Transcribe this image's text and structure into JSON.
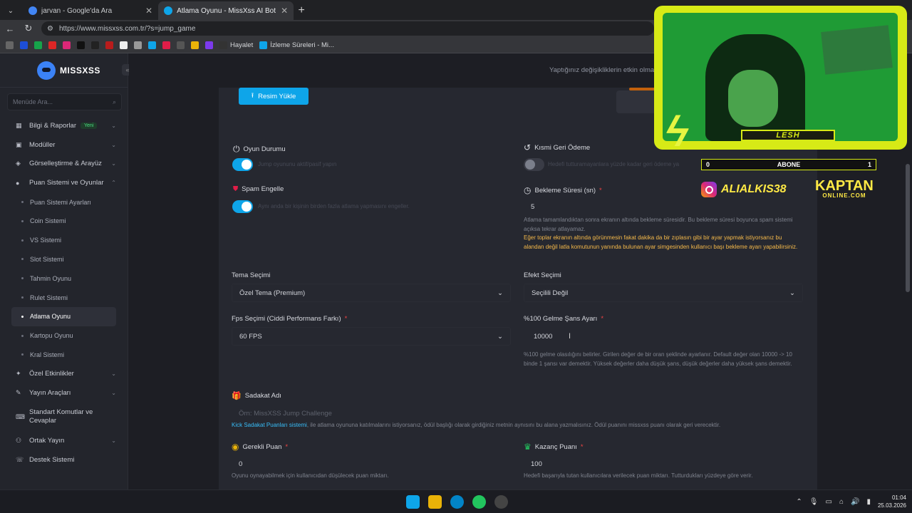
{
  "browser": {
    "tabs": [
      {
        "title": "jarvan - Google'da Ara",
        "favicon_color": "#4285f4",
        "active": false
      },
      {
        "title": "Atlama Oyunu - MissXss AI Bot Sy",
        "favicon_color": "#0ea5e9",
        "active": true
      }
    ],
    "url": "https://www.missxss.com.tr/?s=jump_game",
    "bookmarks": {
      "hayalet": "Hayalet",
      "izleme": "İzleme Süreleri - Mi..."
    }
  },
  "sidebar": {
    "logo": "MISSXSS",
    "search_placeholder": "Menüde Ara...",
    "items": {
      "bilgi": {
        "label": "Bilgi & Raporlar",
        "badge": "Yeni"
      },
      "moduller": {
        "label": "Modüller"
      },
      "gorsel": {
        "label": "Görselleştirme & Arayüz"
      },
      "puan": {
        "label": "Puan Sistemi ve Oyunlar"
      },
      "ozel": {
        "label": "Özel Etkinlikler"
      },
      "yayin": {
        "label": "Yayın Araçları"
      },
      "standart": {
        "label": "Standart Komutlar ve Cevaplar"
      },
      "ortak": {
        "label": "Ortak Yayın"
      },
      "destek": {
        "label": "Destek Sistemi"
      }
    },
    "subitems": [
      "Puan Sistemi Ayarları",
      "Coin Sistemi",
      "VS Sistemi",
      "Slot Sistemi",
      "Tahmin Oyunu",
      "Rulet Sistemi",
      "Atlama Oyunu",
      "Kartopu Oyunu",
      "Kral Sistemi"
    ]
  },
  "page": {
    "top_notice": "Yaptığınız değişikliklerin etkin olması",
    "upload_label": "Resim Yükle",
    "game_status": {
      "label": "Oyun Durumu",
      "hint": "Jump oyununu aktif/pasif yapın",
      "enabled": true
    },
    "partial_refund": {
      "label": "Kısmi Geri Ödeme",
      "hint": "Hedefi tutturamayanlara yüzde kadar geri ödeme ya",
      "enabled": false
    },
    "spam": {
      "label": "Spam Engelle",
      "hint": "Aynı anda bir kişinin birden fazla atlama yapmasını engeller.",
      "enabled": true
    },
    "wait_time": {
      "label": "Bekleme Süresi (sn)",
      "value": "5",
      "hint": "Atlama tamamlandıktan sonra ekranın altında bekleme süresidir. Bu bekleme süresi boyunca spam sistemi açıksa tekrar atlayamaz.",
      "warning": "Eğer toplar ekranın altında görünmesin fakat dakika da bir zıplasın gibi bir ayar yapmak istiyorsanız bu alandan değil latla komutunun yanında bulunan ayar simgesinden kullanıcı başı bekleme ayarı yapabilirsiniz."
    },
    "theme": {
      "label": "Tema Seçimi",
      "value": "Özel Tema (Premium)"
    },
    "effect": {
      "label": "Efekt Seçimi",
      "value": "Seçilili Değil"
    },
    "fps": {
      "label": "Fps Seçimi (Ciddi Performans Farkı)",
      "value": "60 FPS"
    },
    "chance": {
      "label": "%100 Gelme Şans Ayarı",
      "value": "10000",
      "hint": "%100 gelme olasılığını belirler. Girilen değer de bir oran şeklinde ayarlanır. Default değer olan 10000 -> 10 binde 1 şansı var demektir. Yüksek değerler daha düşük şans, düşük değerler daha yüksek şans demektir."
    },
    "loyalty": {
      "label": "Sadakat Adı",
      "placeholder": "Örn: MissXSS Jump Challenge",
      "link": "Kick Sadakat Puanları sistemi",
      "hint": ", ile atlama oyununa katılmalarını istiyorsanız, ödül başlığı olarak girdiğiniz metnin aynısını bu alana yazmalısınız. Ödül puanını missxss puanı olarak geri verecektir."
    },
    "required_points": {
      "label": "Gerekli Puan",
      "value": "0",
      "hint": "Oyunu oynayabilmek için kullanıcıdan düşülecek puan miktarı."
    },
    "win_points": {
      "label": "Kazanç Puanı",
      "value": "100",
      "hint": "Hedefi başarıyla tutan kullanıcılara verilecek puan miktarı. Tutturdukları yüzdeye göre verir."
    }
  },
  "overlay": {
    "name": "LESH",
    "abone_left": "0",
    "abone_label": "ABONE",
    "abone_right": "1",
    "instagram": "ALIALKIS38",
    "kaptan": "KAPTAN",
    "kaptan_sub": "ONLINE.COM"
  },
  "taskbar": {
    "time": "01:04",
    "date": "25.03.2026"
  }
}
